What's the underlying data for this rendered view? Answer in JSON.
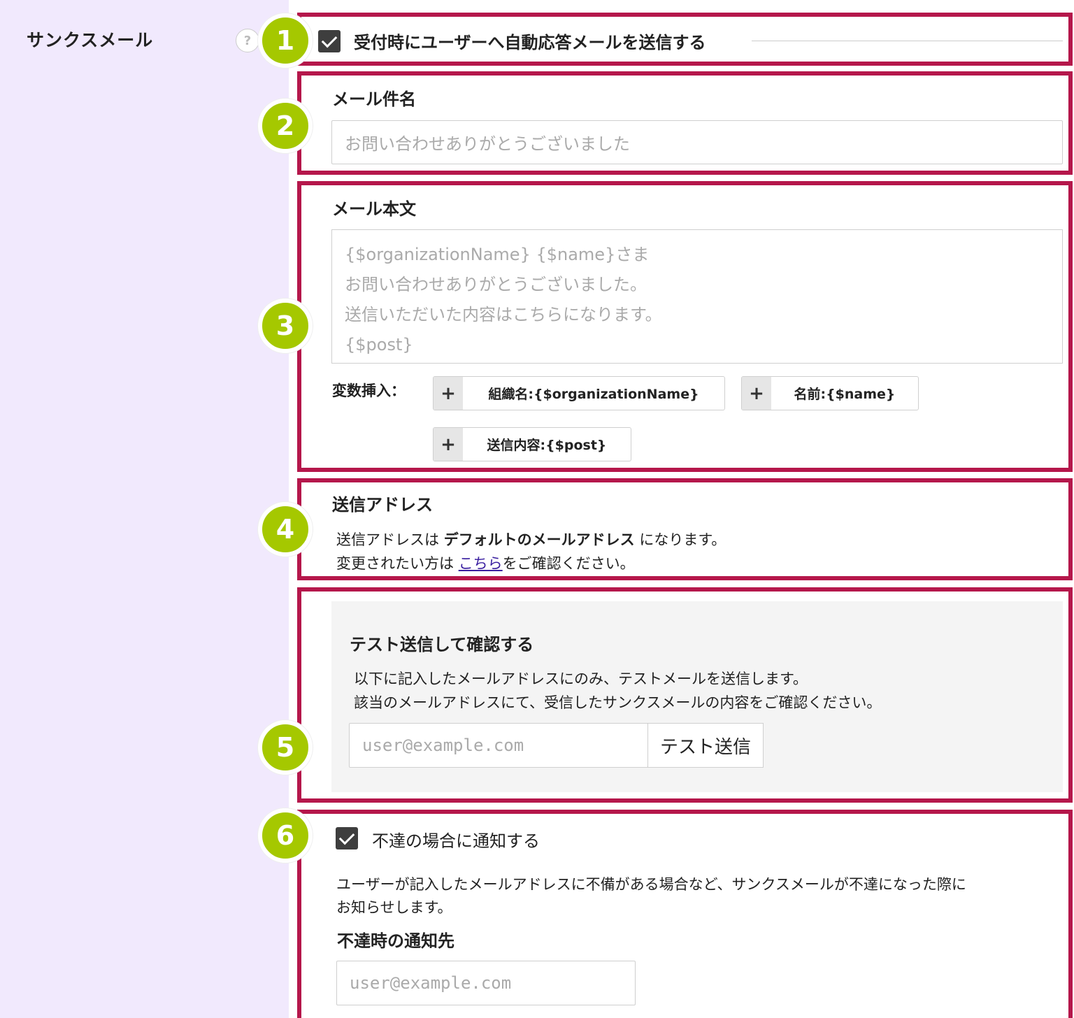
{
  "sidebar": {
    "title": "サンクスメール",
    "help_icon": "?"
  },
  "section1": {
    "badge": "1",
    "checkbox_label": "受付時にユーザーへ自動応答メールを送信する",
    "checked": true
  },
  "section2": {
    "badge": "2",
    "label": "メール件名",
    "placeholder": "お問い合わせありがとうございました"
  },
  "section3": {
    "badge": "3",
    "label": "メール本文",
    "body_placeholder": "{$organizationName} {$name}さま\nお問い合わせありがとうございました。\n送信いただいた内容はこちらになります。\n{$post}",
    "insert_label": "変数挿入：",
    "variables": [
      {
        "icon": "+",
        "label": "組織名:{$organizationName}"
      },
      {
        "icon": "+",
        "label": "名前:{$name}"
      },
      {
        "icon": "+",
        "label": "送信内容:{$post}"
      }
    ]
  },
  "section4": {
    "badge": "4",
    "label": "送信アドレス",
    "line1_prefix": "送信アドレスは",
    "line1_strong": "デフォルトのメールアドレス",
    "line1_suffix": "になります。",
    "line2_prefix": "変更されたい方は",
    "line2_link": "こちら",
    "line2_suffix": "をご確認ください。"
  },
  "section5": {
    "badge": "5",
    "title": "テスト送信して確認する",
    "desc1": "以下に記入したメールアドレスにのみ、テストメールを送信します。",
    "desc2": "該当のメールアドレスにて、受信したサンクスメールの内容をご確認ください。",
    "email_placeholder": "user@example.com",
    "send_button": "テスト送信"
  },
  "section6": {
    "badge": "6",
    "checkbox_label": "不達の場合に通知する",
    "checked": true,
    "desc1": "ユーザーが記入したメールアドレスに不備がある場合など、サンクスメールが不達になった際に",
    "desc2": "お知らせします。",
    "notify_label": "不達時の通知先",
    "email_placeholder": "user@example.com"
  },
  "colors": {
    "frame": "#b5174b",
    "badge": "#a5c800",
    "sidebar_bg": "#f1e9fd"
  }
}
